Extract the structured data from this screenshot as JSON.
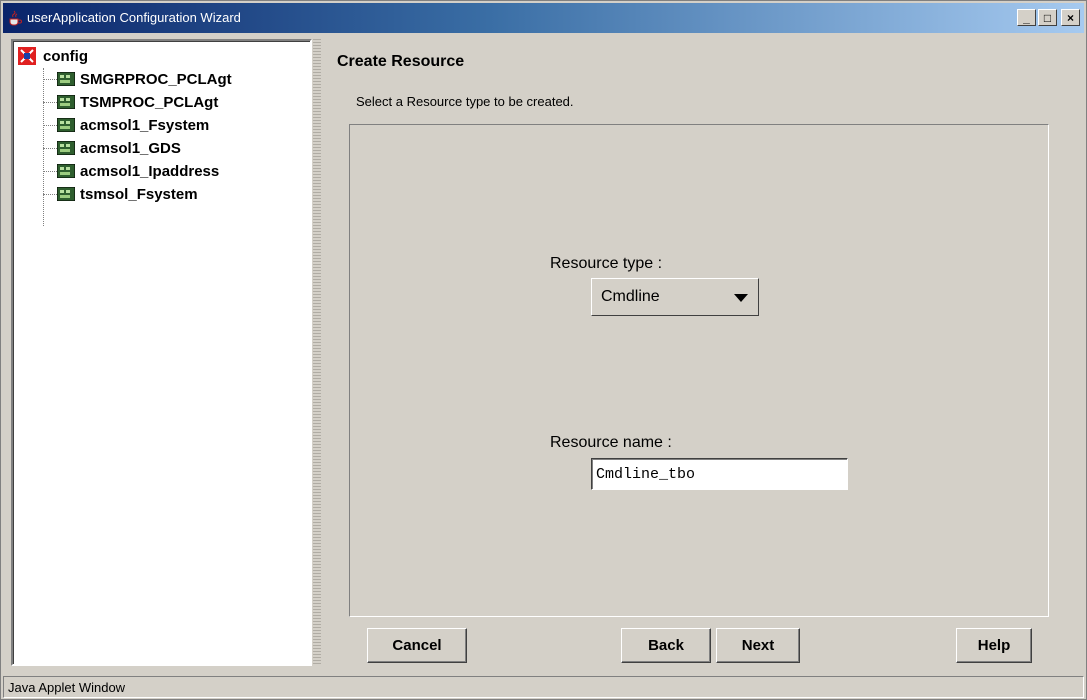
{
  "window": {
    "title": "userApplication Configuration Wizard",
    "minimize": "_",
    "maximize": "□",
    "close": "×"
  },
  "tree": {
    "root": "config",
    "items": [
      {
        "label": "SMGRPROC_PCLAgt",
        "icon": "resource-icon"
      },
      {
        "label": "TSMPROC_PCLAgt",
        "icon": "resource-icon"
      },
      {
        "label": "acmsol1_Fsystem",
        "icon": "resource-icon"
      },
      {
        "label": "acmsol1_GDS",
        "icon": "resource-icon"
      },
      {
        "label": "acmsol1_Ipaddress",
        "icon": "resource-icon"
      },
      {
        "label": "tsmsol_Fsystem",
        "icon": "resource-icon"
      }
    ]
  },
  "main": {
    "heading": "Create Resource",
    "instruction": "Select a Resource type to be created.",
    "resource_type": {
      "label": "Resource type  :",
      "selected": "Cmdline"
    },
    "resource_name": {
      "label": "Resource name  :",
      "value": "Cmdline_tbo"
    }
  },
  "buttons": {
    "cancel": "Cancel",
    "back": "Back",
    "next": "Next",
    "help": "Help"
  },
  "status": "Java Applet Window",
  "colors": {
    "face": "#d4d0c8",
    "title_start": "#0a246a",
    "title_end": "#a6caf0"
  }
}
